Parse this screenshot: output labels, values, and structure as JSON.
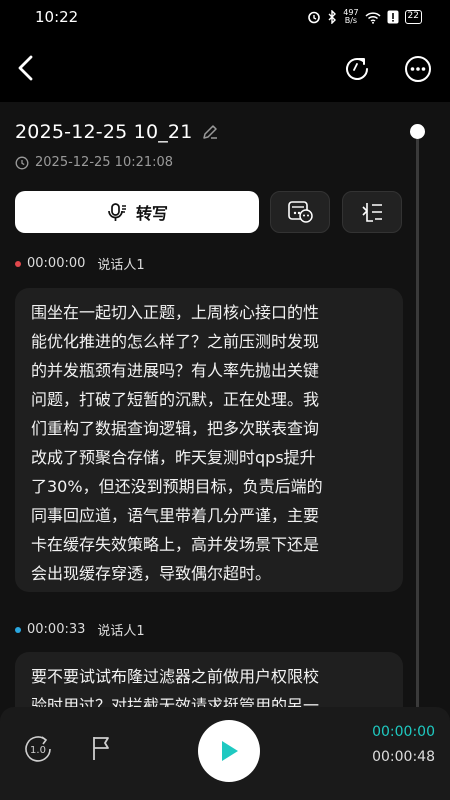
{
  "status_bar": {
    "time": "10:22",
    "net_speed_value": "497",
    "net_speed_unit": "B/s",
    "battery": "22",
    "icons": [
      "alarm-icon",
      "bluetooth-icon",
      "wifi-icon",
      "sim-alert-icon",
      "battery-icon"
    ]
  },
  "header": {
    "icons": [
      "back-icon",
      "refresh-icon",
      "more-icon"
    ]
  },
  "recording": {
    "title": "2025-12-25 10_21",
    "datetime": "2025-12-25 10:21:08"
  },
  "actions": {
    "transcribe_label": "转写",
    "icons": [
      "mic-transcribe-icon",
      "summary-bot-icon",
      "list-outline-icon"
    ]
  },
  "transcript": [
    {
      "time": "00:00:00",
      "speaker": "说话人1",
      "dot_color": "#e0474c",
      "lines": [
        "围坐在一起切入正题，上周核心接口的性",
        "能优化推进的怎么样了？之前压测时发现",
        "的并发瓶颈有进展吗？有人率先抛出关键",
        "问题，打破了短暂的沉默，正在处理。我",
        "们重构了数据查询逻辑，把多次联表查询",
        "改成了预聚合存储，昨天复测时qps提升",
        "了30%，但还没到预期目标，负责后端的",
        "同事回应道，语气里带着几分严谨，主要",
        "卡在缓存失效策略上，高并发场景下还是",
        "会出现缓存穿透，导致偶尔超时。"
      ]
    },
    {
      "time": "00:00:33",
      "speaker": "说话人1",
      "dot_color": "#2aa7e0",
      "lines": [
        "要不要试试布隆过滤器之前做用户权限校",
        "验时用过？对拦截无效请求挺管用的另一"
      ]
    }
  ],
  "player": {
    "speed": "1.0",
    "current_time": "00:00:00",
    "total_time": "00:00:48",
    "accent_color": "#1fc9c1",
    "icons": [
      "speed-icon",
      "flag-icon",
      "play-icon"
    ]
  }
}
